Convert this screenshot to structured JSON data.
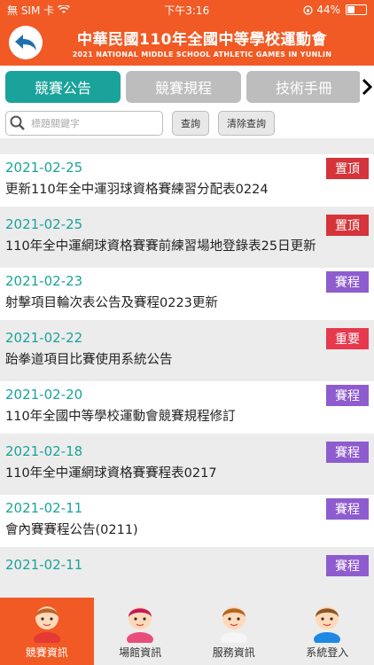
{
  "status": {
    "carrier": "無 SIM 卡",
    "time": "下午3:16",
    "battery": "44%",
    "battery_level": 0.44
  },
  "header": {
    "title": "中華民國110年全國中等學校運動會",
    "subtitle": "2021 NATIONAL MIDDLE SCHOOL ATHLETIC GAMES IN YUNLIN"
  },
  "tabs": [
    {
      "label": "競賽公告"
    },
    {
      "label": "競賽規程"
    },
    {
      "label": "技術手冊"
    }
  ],
  "search": {
    "placeholder": "標題關鍵字",
    "value": "",
    "search_label": "查詢",
    "clear_label": "清除查詢"
  },
  "tag_colors": {
    "pin": "#d4343a",
    "schedule": "#8e5ccf",
    "important": "#e6394e"
  },
  "announcements": [
    {
      "date": "2021-02-25",
      "text": "更新110年全中運羽球資格賽練習分配表0224",
      "tag": "置頂",
      "tag_type": "pin"
    },
    {
      "date": "2021-02-25",
      "text": "110年全中運網球資格賽賽前練習場地登錄表25日更新",
      "tag": "置頂",
      "tag_type": "pin"
    },
    {
      "date": "2021-02-23",
      "text": "射擊項目輪次表公告及賽程0223更新",
      "tag": "賽程",
      "tag_type": "schedule"
    },
    {
      "date": "2021-02-22",
      "text": "跆拳道項目比賽使用系統公告",
      "tag": "重要",
      "tag_type": "important"
    },
    {
      "date": "2021-02-20",
      "text": "110年全國中等學校運動會競賽規程修訂",
      "tag": "賽程",
      "tag_type": "schedule"
    },
    {
      "date": "2021-02-18",
      "text": "110年全中運網球資格賽賽程表0217",
      "tag": "賽程",
      "tag_type": "schedule"
    },
    {
      "date": "2021-02-11",
      "text": "會內賽賽程公告(0211)",
      "tag": "賽程",
      "tag_type": "schedule"
    },
    {
      "date": "2021-02-11",
      "text": "",
      "tag": "賽程",
      "tag_type": "schedule"
    }
  ],
  "bottom_nav": [
    {
      "label": "競賽資訊",
      "icon": "boxer-avatar-icon"
    },
    {
      "label": "場館資訊",
      "icon": "gymnast-avatar-icon"
    },
    {
      "label": "服務資訊",
      "icon": "volunteer-avatar-icon"
    },
    {
      "label": "系統登入",
      "icon": "cyclist-avatar-icon"
    }
  ]
}
